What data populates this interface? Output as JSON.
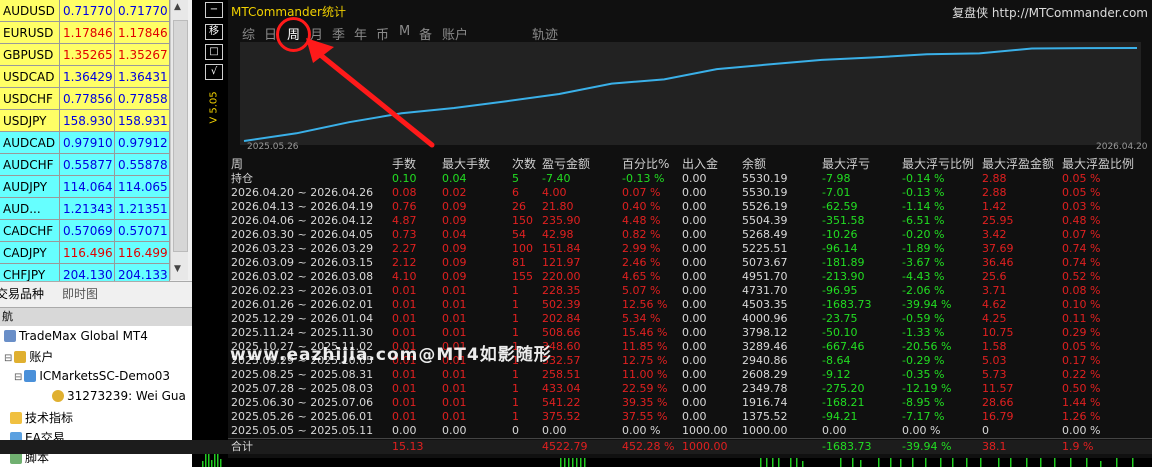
{
  "market_watch": {
    "rows": [
      {
        "symbol": "AUDUSD",
        "bid": "0.71770",
        "ask": "0.71770",
        "bg": "#ffff66",
        "dir": "blue"
      },
      {
        "symbol": "EURUSD",
        "bid": "1.17846",
        "ask": "1.17846",
        "bg": "#ffff66",
        "dir": "red"
      },
      {
        "symbol": "GBPUSD",
        "bid": "1.35265",
        "ask": "1.35267",
        "bg": "#ffff66",
        "dir": "red"
      },
      {
        "symbol": "USDCAD",
        "bid": "1.36429",
        "ask": "1.36431",
        "bg": "#ffff66",
        "dir": "blue"
      },
      {
        "symbol": "USDCHF",
        "bid": "0.77856",
        "ask": "0.77858",
        "bg": "#ffff66",
        "dir": "blue"
      },
      {
        "symbol": "USDJPY",
        "bid": "158.930",
        "ask": "158.931",
        "bg": "#ffff66",
        "dir": "blue"
      },
      {
        "symbol": "AUDCAD",
        "bid": "0.97910",
        "ask": "0.97912",
        "bg": "#66ffff",
        "dir": "blue"
      },
      {
        "symbol": "AUDCHF",
        "bid": "0.55877",
        "ask": "0.55878",
        "bg": "#66ffff",
        "dir": "blue"
      },
      {
        "symbol": "AUDJPY",
        "bid": "114.064",
        "ask": "114.065",
        "bg": "#66ffff",
        "dir": "blue"
      },
      {
        "symbol": "AUD...",
        "bid": "1.21343",
        "ask": "1.21351",
        "bg": "#66ffff",
        "dir": "blue"
      },
      {
        "symbol": "CADCHF",
        "bid": "0.57069",
        "ask": "0.57071",
        "bg": "#66ffff",
        "dir": "blue"
      },
      {
        "symbol": "CADJPY",
        "bid": "116.496",
        "ask": "116.499",
        "bg": "#66ffff",
        "dir": "red"
      },
      {
        "symbol": "CHFJPY",
        "bid": "204.130",
        "ask": "204.133",
        "bg": "#66ffff",
        "dir": "blue"
      }
    ],
    "tabs": [
      "交易品种",
      "即时图"
    ]
  },
  "navigator": {
    "header": "航",
    "items": [
      {
        "label": "TradeMax Global MT4",
        "icon": "folder-icon"
      },
      {
        "label": "账户",
        "icon": "accounts-icon"
      },
      {
        "label": "ICMarketsSC-Demo03",
        "icon": "server-icon"
      },
      {
        "label": "31273239: Wei Gua",
        "icon": "user-icon"
      },
      {
        "label": "技术指标",
        "icon": "indicator-icon"
      },
      {
        "label": "EA交易",
        "icon": "expert-icon"
      },
      {
        "label": "脚本",
        "icon": "script-icon"
      }
    ],
    "expander": "⊟"
  },
  "chart_window": {
    "buttons": [
      "−",
      "移",
      "□",
      "√"
    ]
  },
  "panel": {
    "title": "MTCommander统计",
    "right_text": "复盘侠",
    "right_url": "http://MTCommander.com",
    "tabs": [
      "综",
      "日",
      "周",
      "月",
      "季",
      "年",
      "币",
      "M",
      "备",
      "账户",
      "轨迹"
    ],
    "active_tab": "周",
    "vertical_label": "V 5.05",
    "date_start": "2025.05.26",
    "date_end": "2026.04.20",
    "accent": "#3ab0e8"
  },
  "table": {
    "headers": [
      "周",
      "手数",
      "最大手数",
      "次数",
      "盈亏金额",
      "百分比%",
      "出入金",
      "余额",
      "最大浮亏",
      "最大浮亏比例",
      "最大浮盈金额",
      "最大浮盈比例"
    ],
    "holding": {
      "label": "持仓",
      "lots": "0.10",
      "max_lots": "0.04",
      "count": "5",
      "pnl": "-7.40",
      "pct": "-0.13 %",
      "flow": "0.00",
      "balance": "5530.19",
      "max_loss": "-7.98",
      "max_loss_pct": "-0.14 %",
      "max_profit": "2.88",
      "max_profit_pct": "0.05 %"
    },
    "rows": [
      {
        "period": "2026.04.20 ~ 2026.04.26",
        "lots": "0.08",
        "max_lots": "0.02",
        "count": "6",
        "pnl": "4.00",
        "pct": "0.07 %",
        "flow": "0.00",
        "balance": "5530.19",
        "max_loss": "-7.01",
        "max_loss_pct": "-0.13 %",
        "max_profit": "2.88",
        "max_profit_pct": "0.05 %"
      },
      {
        "period": "2026.04.13 ~ 2026.04.19",
        "lots": "0.76",
        "max_lots": "0.09",
        "count": "26",
        "pnl": "21.80",
        "pct": "0.40 %",
        "flow": "0.00",
        "balance": "5526.19",
        "max_loss": "-62.59",
        "max_loss_pct": "-1.14 %",
        "max_profit": "1.42",
        "max_profit_pct": "0.03 %"
      },
      {
        "period": "2026.04.06 ~ 2026.04.12",
        "lots": "4.87",
        "max_lots": "0.09",
        "count": "150",
        "pnl": "235.90",
        "pct": "4.48 %",
        "flow": "0.00",
        "balance": "5504.39",
        "max_loss": "-351.58",
        "max_loss_pct": "-6.51 %",
        "max_profit": "25.95",
        "max_profit_pct": "0.48 %"
      },
      {
        "period": "2026.03.30 ~ 2026.04.05",
        "lots": "0.73",
        "max_lots": "0.04",
        "count": "54",
        "pnl": "42.98",
        "pct": "0.82 %",
        "flow": "0.00",
        "balance": "5268.49",
        "max_loss": "-10.26",
        "max_loss_pct": "-0.20 %",
        "max_profit": "3.42",
        "max_profit_pct": "0.07 %"
      },
      {
        "period": "2026.03.23 ~ 2026.03.29",
        "lots": "2.27",
        "max_lots": "0.09",
        "count": "100",
        "pnl": "151.84",
        "pct": "2.99 %",
        "flow": "0.00",
        "balance": "5225.51",
        "max_loss": "-96.14",
        "max_loss_pct": "-1.89 %",
        "max_profit": "37.69",
        "max_profit_pct": "0.74 %"
      },
      {
        "period": "2026.03.09 ~ 2026.03.15",
        "lots": "2.12",
        "max_lots": "0.09",
        "count": "81",
        "pnl": "121.97",
        "pct": "2.46 %",
        "flow": "0.00",
        "balance": "5073.67",
        "max_loss": "-181.89",
        "max_loss_pct": "-3.67 %",
        "max_profit": "36.46",
        "max_profit_pct": "0.74 %"
      },
      {
        "period": "2026.03.02 ~ 2026.03.08",
        "lots": "4.10",
        "max_lots": "0.09",
        "count": "155",
        "pnl": "220.00",
        "pct": "4.65 %",
        "flow": "0.00",
        "balance": "4951.70",
        "max_loss": "-213.90",
        "max_loss_pct": "-4.43 %",
        "max_profit": "25.6",
        "max_profit_pct": "0.52 %"
      },
      {
        "period": "2026.02.23 ~ 2026.03.01",
        "lots": "0.01",
        "max_lots": "0.01",
        "count": "1",
        "pnl": "228.35",
        "pct": "5.07 %",
        "flow": "0.00",
        "balance": "4731.70",
        "max_loss": "-96.95",
        "max_loss_pct": "-2.06 %",
        "max_profit": "3.71",
        "max_profit_pct": "0.08 %"
      },
      {
        "period": "2026.01.26 ~ 2026.02.01",
        "lots": "0.01",
        "max_lots": "0.01",
        "count": "1",
        "pnl": "502.39",
        "pct": "12.56 %",
        "flow": "0.00",
        "balance": "4503.35",
        "max_loss": "-1683.73",
        "max_loss_pct": "-39.94 %",
        "max_profit": "4.62",
        "max_profit_pct": "0.10 %"
      },
      {
        "period": "2025.12.29 ~ 2026.01.04",
        "lots": "0.01",
        "max_lots": "0.01",
        "count": "1",
        "pnl": "202.84",
        "pct": "5.34 %",
        "flow": "0.00",
        "balance": "4000.96",
        "max_loss": "-23.75",
        "max_loss_pct": "-0.59 %",
        "max_profit": "4.25",
        "max_profit_pct": "0.11 %"
      },
      {
        "period": "2025.11.24 ~ 2025.11.30",
        "lots": "0.01",
        "max_lots": "0.01",
        "count": "1",
        "pnl": "508.66",
        "pct": "15.46 %",
        "flow": "0.00",
        "balance": "3798.12",
        "max_loss": "-50.10",
        "max_loss_pct": "-1.33 %",
        "max_profit": "10.75",
        "max_profit_pct": "0.29 %"
      },
      {
        "period": "2025.10.27 ~ 2025.11.02",
        "lots": "0.01",
        "max_lots": "0.01",
        "count": "1",
        "pnl": "348.60",
        "pct": "11.85 %",
        "flow": "0.00",
        "balance": "3289.46",
        "max_loss": "-667.46",
        "max_loss_pct": "-20.56 %",
        "max_profit": "1.58",
        "max_profit_pct": "0.05 %"
      },
      {
        "period": "2025.09.29 ~ 2025.10.05",
        "lots": "0.01",
        "max_lots": "0.01",
        "count": "1",
        "pnl": "332.57",
        "pct": "12.75 %",
        "flow": "0.00",
        "balance": "2940.86",
        "max_loss": "-8.64",
        "max_loss_pct": "-0.29 %",
        "max_profit": "5.03",
        "max_profit_pct": "0.17 %"
      },
      {
        "period": "2025.08.25 ~ 2025.08.31",
        "lots": "0.01",
        "max_lots": "0.01",
        "count": "1",
        "pnl": "258.51",
        "pct": "11.00 %",
        "flow": "0.00",
        "balance": "2608.29",
        "max_loss": "-9.12",
        "max_loss_pct": "-0.35 %",
        "max_profit": "5.73",
        "max_profit_pct": "0.22 %"
      },
      {
        "period": "2025.07.28 ~ 2025.08.03",
        "lots": "0.01",
        "max_lots": "0.01",
        "count": "1",
        "pnl": "433.04",
        "pct": "22.59 %",
        "flow": "0.00",
        "balance": "2349.78",
        "max_loss": "-275.20",
        "max_loss_pct": "-12.19 %",
        "max_profit": "11.57",
        "max_profit_pct": "0.50 %"
      },
      {
        "period": "2025.06.30 ~ 2025.07.06",
        "lots": "0.01",
        "max_lots": "0.01",
        "count": "1",
        "pnl": "541.22",
        "pct": "39.35 %",
        "flow": "0.00",
        "balance": "1916.74",
        "max_loss": "-168.21",
        "max_loss_pct": "-8.95 %",
        "max_profit": "28.66",
        "max_profit_pct": "1.44 %"
      },
      {
        "period": "2025.05.26 ~ 2025.06.01",
        "lots": "0.01",
        "max_lots": "0.01",
        "count": "1",
        "pnl": "375.52",
        "pct": "37.55 %",
        "flow": "0.00",
        "balance": "1375.52",
        "max_loss": "-94.21",
        "max_loss_pct": "-7.17 %",
        "max_profit": "16.79",
        "max_profit_pct": "1.26 %"
      },
      {
        "period": "2025.05.05 ~ 2025.05.11",
        "lots": "0.00",
        "max_lots": "0.00",
        "count": "0",
        "pnl": "0.00",
        "pct": "0.00 %",
        "flow": "1000.00",
        "balance": "1000.00",
        "max_loss": "0.00",
        "max_loss_pct": "0.00 %",
        "max_profit": "0",
        "max_profit_pct": "0.00 %",
        "plain": true
      }
    ],
    "total": {
      "label": "合计",
      "lots": "15.13",
      "max_lots": "",
      "count": "",
      "pnl": "4522.79",
      "pct": "452.28 %",
      "flow": "1000.00",
      "balance": "",
      "max_loss": "-1683.73",
      "max_loss_pct": "-39.94 %",
      "max_profit": "38.1",
      "max_profit_pct": "1.9 %"
    }
  },
  "watermark": "www.eazhijia.com@MT4如影随形",
  "equity_series": [
    1000.0,
    1375.52,
    1916.74,
    2349.78,
    2608.29,
    2940.86,
    3289.46,
    3798.12,
    4000.96,
    4503.35,
    4731.7,
    4951.7,
    5073.67,
    5225.51,
    5268.49,
    5504.39,
    5526.19,
    5530.19
  ]
}
